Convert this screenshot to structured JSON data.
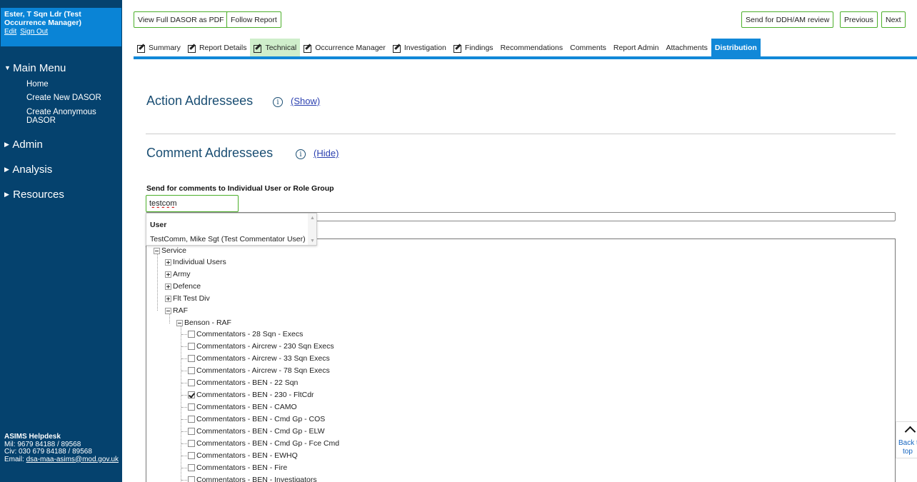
{
  "sidebar": {
    "user_name": "Ester, T Sqn Ldr (Test Occurrence Manager)",
    "edit_link": "Edit",
    "signout_link": "Sign Out",
    "main_menu": "Main Menu",
    "main_items": [
      "Home",
      "Create New DASOR",
      "Create Anonymous DASOR"
    ],
    "admin": "Admin",
    "analysis": "Analysis",
    "resources": "Resources",
    "helpdesk": {
      "title": "ASIMS Helpdesk",
      "mil": "Mil: 9679 84188 / 89568",
      "civ": "Civ: 030 679 84188 / 89568",
      "email_label": "Email:",
      "email": "dsa-maa-asims@mod.gov.uk"
    }
  },
  "toolbar": {
    "view_pdf": "View Full DASOR as PDF",
    "follow": "Follow Report",
    "send_review": "Send for DDH/AM review",
    "previous": "Previous",
    "next": "Next"
  },
  "tabs": [
    {
      "label": "Summary",
      "icon": "edit-icon",
      "state": "normal"
    },
    {
      "label": "Report Details",
      "icon": "edit-icon",
      "state": "normal"
    },
    {
      "label": "Technical",
      "icon": "edit-icon",
      "state": "highlight"
    },
    {
      "label": "Occurrence Manager",
      "icon": "edit-icon",
      "state": "normal"
    },
    {
      "label": "Investigation",
      "icon": "edit-icon",
      "state": "normal"
    },
    {
      "label": "Findings",
      "icon": "edit-icon",
      "state": "normal"
    },
    {
      "label": "Recommendations",
      "icon": "",
      "state": "normal"
    },
    {
      "label": "Comments",
      "icon": "",
      "state": "normal"
    },
    {
      "label": "Report Admin",
      "icon": "",
      "state": "normal"
    },
    {
      "label": "Attachments",
      "icon": "",
      "state": "normal"
    },
    {
      "label": "Distribution",
      "icon": "",
      "state": "active"
    }
  ],
  "action_addressees": {
    "title": "Action Addressees",
    "toggle": "(Show)",
    "info_icon": "info-icon"
  },
  "comment_addressees": {
    "title": "Comment Addressees",
    "toggle": "(Hide)",
    "info_icon": "info-icon"
  },
  "search": {
    "label": "Send for comments to Individual User or Role Group",
    "value": "testcom"
  },
  "dropdown": {
    "header": "User",
    "item": "TestComm, Mike Sgt (Test Commentator User)"
  },
  "tree": {
    "service": "Service",
    "service_children": [
      "Individual Users",
      "Army",
      "Defence",
      "Flt Test Div"
    ],
    "raf": "RAF",
    "benson": "Benson - RAF",
    "leaves": [
      {
        "label": "Commentators - 28 Sqn - Execs",
        "checked": false
      },
      {
        "label": "Commentators - Aircrew - 230 Sqn Execs",
        "checked": false
      },
      {
        "label": "Commentators - Aircrew - 33 Sqn Execs",
        "checked": false
      },
      {
        "label": "Commentators - Aircrew - 78 Sqn Execs",
        "checked": false
      },
      {
        "label": "Commentators - BEN - 22 Sqn",
        "checked": false
      },
      {
        "label": "Commentators - BEN - 230 - FltCdr",
        "checked": true
      },
      {
        "label": "Commentators - BEN - CAMO",
        "checked": false
      },
      {
        "label": "Commentators - BEN - Cmd Gp - COS",
        "checked": false
      },
      {
        "label": "Commentators - BEN - Cmd Gp - ELW",
        "checked": false
      },
      {
        "label": "Commentators - BEN - Cmd Gp - Fce Cmd",
        "checked": false
      },
      {
        "label": "Commentators - BEN - EWHQ",
        "checked": false
      },
      {
        "label": "Commentators - BEN - Fire",
        "checked": false
      },
      {
        "label": "Commentators - BEN - Investigators",
        "checked": false
      }
    ]
  },
  "back_to_top": {
    "line1": "Back t",
    "line2": "top"
  }
}
